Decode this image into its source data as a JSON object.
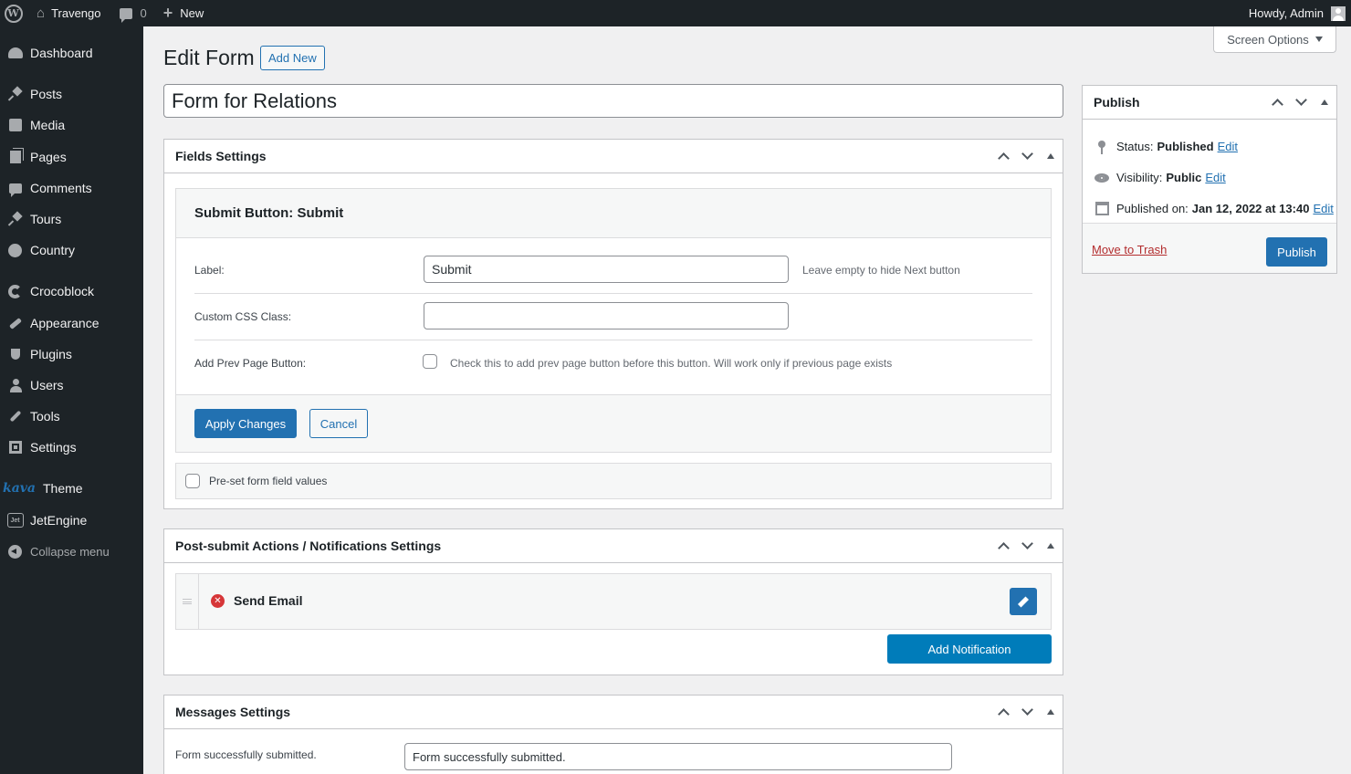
{
  "admin_bar": {
    "site_name": "Travengo",
    "comment_count": "0",
    "new_label": "New",
    "howdy": "Howdy, Admin"
  },
  "sidebar": {
    "items": [
      {
        "label": "Dashboard",
        "icon": "dashboard-icon"
      },
      {
        "label": "Posts",
        "icon": "pin-icon"
      },
      {
        "label": "Media",
        "icon": "media-icon"
      },
      {
        "label": "Pages",
        "icon": "pages-icon"
      },
      {
        "label": "Comments",
        "icon": "comments-icon"
      },
      {
        "label": "Tours",
        "icon": "pin-icon"
      },
      {
        "label": "Country",
        "icon": "globe-icon"
      },
      {
        "label": "Crocoblock",
        "icon": "crocoblock-icon"
      },
      {
        "label": "Appearance",
        "icon": "brush-icon"
      },
      {
        "label": "Plugins",
        "icon": "plug-icon"
      },
      {
        "label": "Users",
        "icon": "user-icon"
      },
      {
        "label": "Tools",
        "icon": "wrench-icon"
      },
      {
        "label": "Settings",
        "icon": "settings-icon"
      },
      {
        "label": "Theme",
        "icon": "kava-logo",
        "logo_text": "kava"
      },
      {
        "label": "JetEngine",
        "icon": "jetengine-icon",
        "logo_text": "Jet"
      },
      {
        "label": "Collapse menu",
        "icon": "collapse-icon"
      }
    ]
  },
  "screen_options": "Screen Options",
  "page": {
    "title": "Edit Form",
    "add_new": "Add New",
    "form_title": "Form for Relations"
  },
  "fields_settings": {
    "heading": "Fields Settings",
    "field_heading": "Submit Button: Submit",
    "label_label": "Label:",
    "label_value": "Submit",
    "label_hint": "Leave empty to hide Next button",
    "css_label": "Custom CSS Class:",
    "css_value": "",
    "prev_label": "Add Prev Page Button:",
    "prev_hint": "Check this to add prev page button before this button. Will work only if previous page exists",
    "apply": "Apply Changes",
    "cancel": "Cancel",
    "preset_label": "Pre-set form field values"
  },
  "notifications": {
    "heading": "Post-submit Actions / Notifications Settings",
    "item": "Send Email",
    "add": "Add Notification"
  },
  "messages": {
    "heading": "Messages Settings",
    "success_label": "Form successfully submitted.",
    "success_value": "Form successfully submitted."
  },
  "publish": {
    "heading": "Publish",
    "status_label": "Status:",
    "status_value": "Published",
    "visibility_label": "Visibility:",
    "visibility_value": "Public",
    "published_label": "Published on:",
    "published_value": "Jan 12, 2022 at 13:40",
    "edit": "Edit",
    "trash": "Move to Trash",
    "publish_btn": "Publish"
  },
  "colors": {
    "accent": "#2271b1",
    "admin_dark": "#1d2327",
    "danger": "#d63638"
  }
}
